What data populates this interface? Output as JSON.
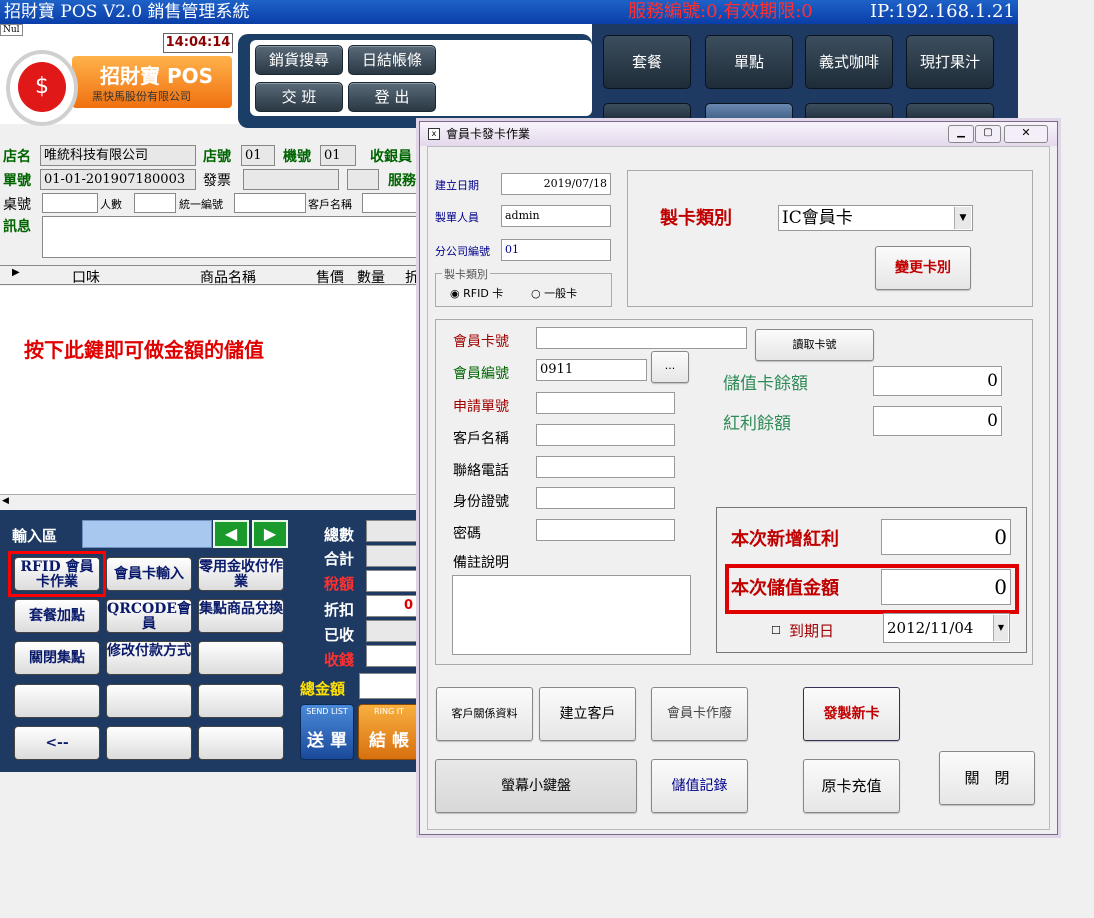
{
  "app": {
    "title": "招財寶 POS V2.0 銷售管理系統",
    "service_info": "服務編號:0,有效期限:0",
    "ip": "IP:192.168.1.21",
    "nul_label": "Nul",
    "clock": "14:04:14",
    "logo_name": "招財寶 POS",
    "logo_company": "黑快馬股份有限公司",
    "logo_symbol": "$"
  },
  "top_buttons": [
    "銷貨搜尋",
    "日結帳條",
    "交 班",
    "登 出"
  ],
  "product_buttons": [
    "套餐",
    "單點",
    "義式咖啡",
    "現打果汁"
  ],
  "info": {
    "store_label": "店名",
    "store_value": "唯統科技有限公司",
    "store_no_label": "店號",
    "store_no_value": "01",
    "machine_label": "機號",
    "machine_value": "01",
    "cashier_label": "收銀員",
    "order_label": "單號",
    "order_value": "01-01-201907180003",
    "invoice_label": "發票",
    "service_label": "服務",
    "table_label": "桌號",
    "people_label": "人數",
    "tax_id_label": "統一編號",
    "customer_label": "客戶名稱",
    "message_label": "訊息"
  },
  "grid": {
    "columns": [
      "口味",
      "商品名稱",
      "售價",
      "數量",
      "折"
    ],
    "hint": "按下此鍵即可做金額的儲值"
  },
  "bottom": {
    "input_label": "輸入區",
    "arrow_left": "◀",
    "arrow_right": "▶",
    "buttons": [
      "RFID 會員卡作業",
      "會員卡輸入",
      "零用金收付作業",
      "套餐加點",
      "QRCODE會員",
      "集點商品兌換",
      "關閉集點",
      "修改付款方式",
      "",
      "",
      "",
      "",
      "<--",
      "",
      ""
    ],
    "totals": {
      "count_label": "總數",
      "sum_label": "合計",
      "tax_label": "稅額",
      "discount_label": "折扣",
      "discount_value": "0",
      "received_label": "已收",
      "change_label": "收錢",
      "grand_label": "總金額"
    },
    "send_label": "送 單",
    "send_caption": "SEND LIST",
    "checkout_label": "結 帳",
    "checkout_caption": "RING IT"
  },
  "dialog": {
    "title": "會員卡發卡作業",
    "created_date_label": "建立日期",
    "created_date_value": "2019/07/18",
    "creator_label": "製單人員",
    "creator_value": "admin",
    "branch_label": "分公司編號",
    "branch_value": "01",
    "card_type_group_label": "製卡類別",
    "radio_rfid": "RFID 卡",
    "radio_normal": "一般卡",
    "card_category_label": "製卡類別",
    "card_category_value": "IC會員卡",
    "change_type_button": "變更卡別",
    "member_card_no_label": "會員卡號",
    "member_card_no_value": "",
    "read_card_button": "讀取卡號",
    "member_no_label": "會員編號",
    "member_no_value": "0911",
    "member_no_button": "...",
    "apply_no_label": "申請單號",
    "customer_name_label": "客戶名稱",
    "phone_label": "聯絡電話",
    "id_label": "身份證號",
    "password_label": "密碼",
    "notes_label": "備註說明",
    "stored_balance_label": "儲值卡餘額",
    "stored_balance_value": "0",
    "bonus_balance_label": "紅利餘額",
    "bonus_balance_value": "0",
    "new_bonus_label": "本次新增紅利",
    "new_bonus_value": "0",
    "stored_amount_label": "本次儲值金額",
    "stored_amount_value": "0",
    "expiry_label": "到期日",
    "expiry_value": "2012/11/04",
    "buttons": {
      "customer_relation": "客戶關係資料",
      "create_customer": "建立客戶",
      "void_card": "會員卡作廢",
      "issue_card": "發製新卡",
      "keyboard": "螢幕小鍵盤",
      "stored_records": "儲值記錄",
      "recharge": "原卡充值",
      "close": "關　閉"
    }
  },
  "colors": {
    "title_bar": "#0a3ea8",
    "panel_navy": "#1e3a62",
    "highlight_red": "#e00000",
    "label_red": "#a00000",
    "label_green": "#006400"
  }
}
